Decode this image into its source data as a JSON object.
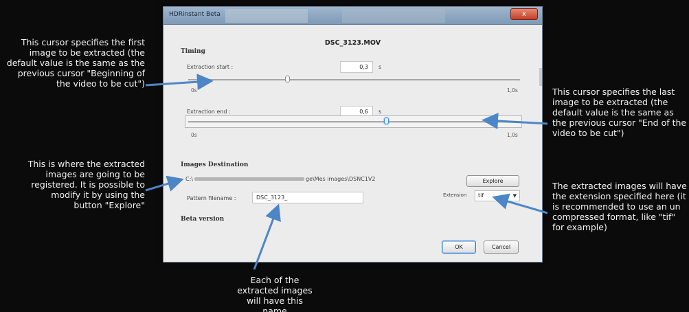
{
  "annotations": {
    "first_image": "This cursor specifies the first image to be extracted (the default value is the same as the previous cursor \"Beginning of the video to be cut\")",
    "last_image": "This cursor specifies the last image to be extracted (the default value is the same as the previous cursor \"End of the video to be cut\")",
    "destination": "This is where the extracted images are going to be registered. It is possible to modify it by using the button \"Explore\"",
    "extension": "The extracted images will have the extension specified here (it is recommended to use an un compressed format, like \"tif\" for example)",
    "filename": "Each of the extracted images will have this name"
  },
  "window": {
    "title": "HDRinstant Beta",
    "close_label": "x"
  },
  "dialog": {
    "filename": "DSC_3123.MOV",
    "timing_title": "Timing",
    "extraction_start_label": "Extraction start :",
    "extraction_start_value": "0,3",
    "extraction_end_label": "Extraction end :",
    "extraction_end_value": "0,6",
    "unit": "s",
    "slider_min": "0s",
    "slider_max": "1,0s",
    "start_fraction": 0.3,
    "end_fraction": 0.6,
    "destination_title": "Images Destination",
    "path_prefix": "C:\\",
    "path_suffix": "ge\\Mes images\\DSNC1V2",
    "explore_label": "Explore",
    "pattern_label": "Pattern filename :",
    "pattern_value": "DSC_3123_",
    "extension_label": "Extension",
    "extension_value": "tif",
    "beta_label": "Beta version",
    "ok_label": "OK",
    "cancel_label": "Cancel"
  },
  "colors": {
    "arrow": "#4d86c6",
    "focus": "#3d8fe0"
  }
}
